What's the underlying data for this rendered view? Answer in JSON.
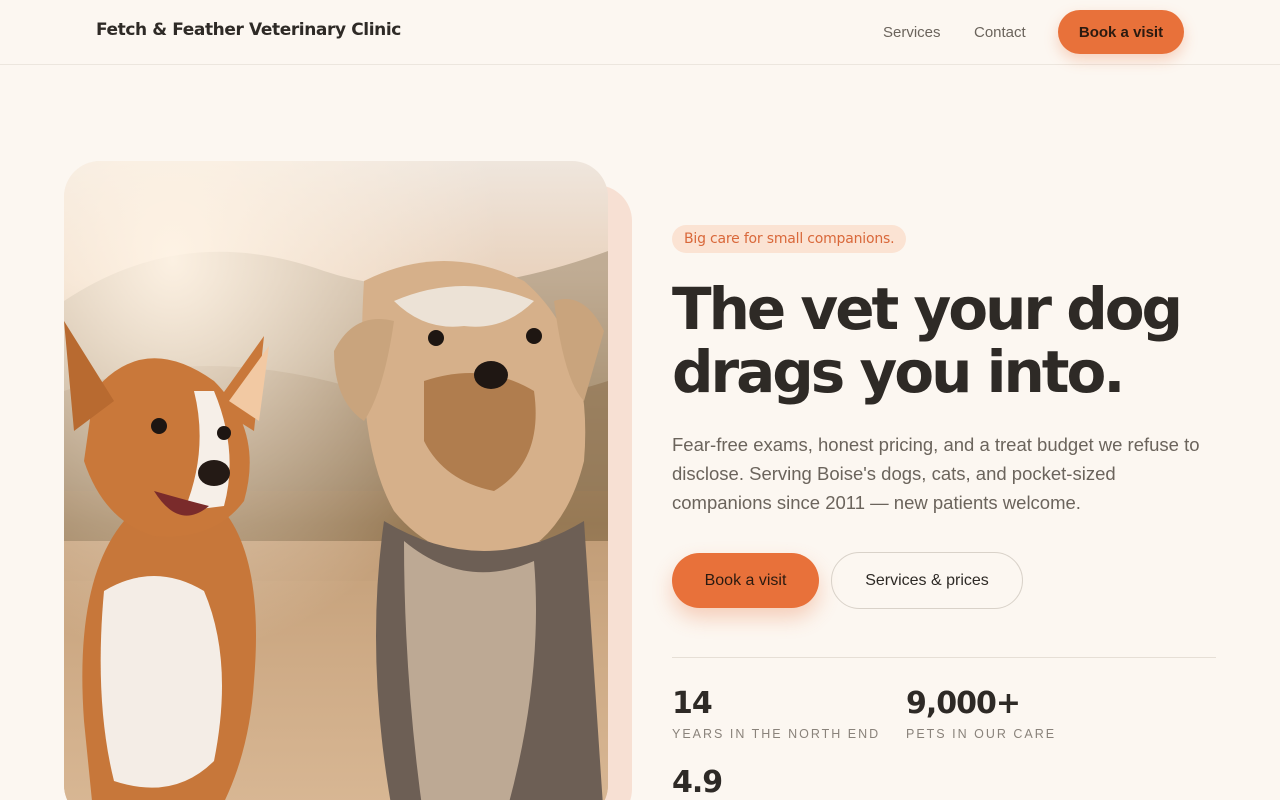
{
  "header": {
    "brand": "Fetch & Feather Veterinary Clinic",
    "nav": [
      {
        "label": "Services"
      },
      {
        "label": "Contact"
      }
    ],
    "cta_label": "Book a visit"
  },
  "hero": {
    "eyebrow": "Big care for small companions.",
    "headline_line1": "The vet your dog",
    "headline_line2": "drags you into.",
    "lede": "Fear-free exams, honest pricing, and a treat budget we refuse to disclose. Serving Boise's dogs, cats, and pocket-sized companions since 2011 — new patients welcome.",
    "primary_cta": "Book a visit",
    "secondary_cta": "Services & prices",
    "stats": [
      {
        "value": "14",
        "label": "Years in the North End"
      },
      {
        "value": "9,000+",
        "label": "Pets in our care"
      },
      {
        "value": "4.9",
        "label": ""
      }
    ]
  },
  "colors": {
    "background": "#fcf7f1",
    "accent": "#e8713a",
    "accent_soft": "#fbe3d3",
    "text": "#2e2a26",
    "muted": "#6b645c"
  }
}
